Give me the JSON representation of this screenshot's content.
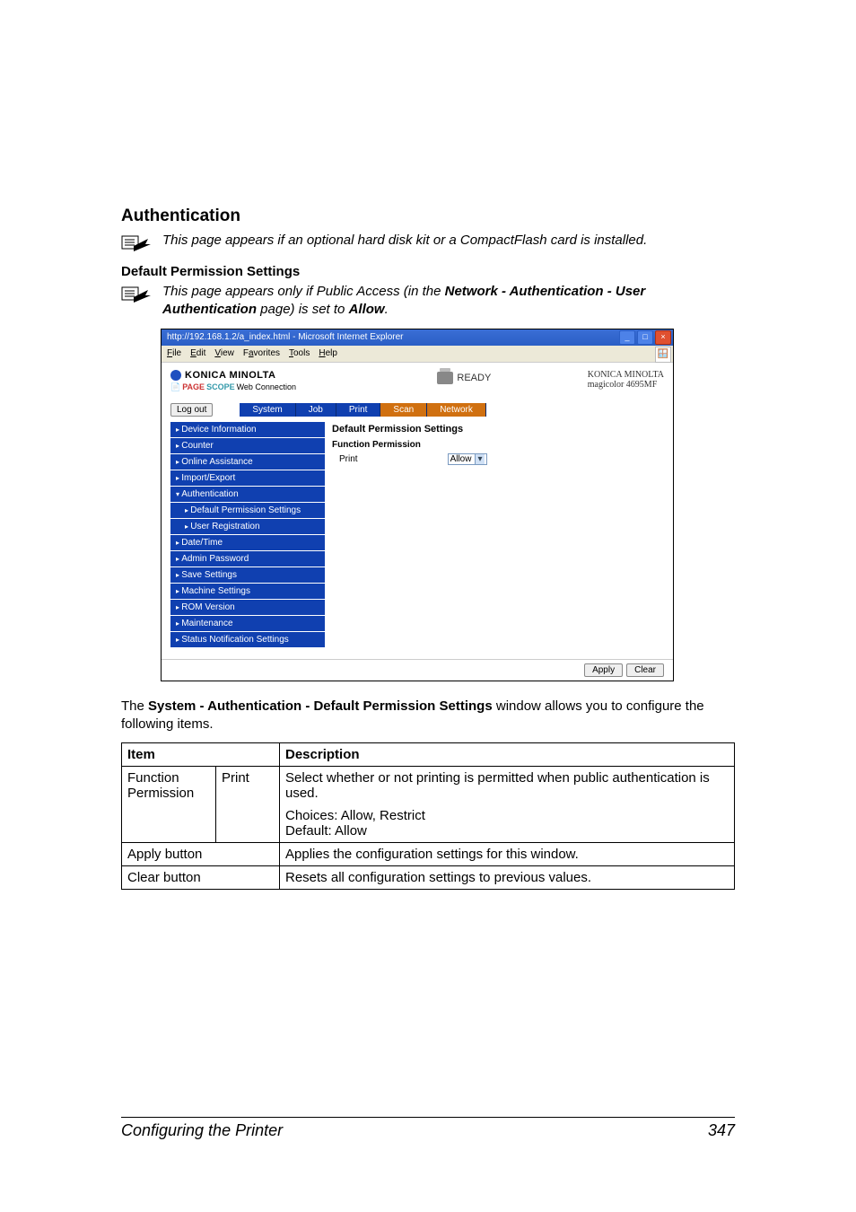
{
  "headings": {
    "authentication": "Authentication",
    "default_permission_settings": "Default Permission Settings"
  },
  "notes": {
    "hard_disk": "This page appears if an optional hard disk kit or a CompactFlash card is installed.",
    "public_access_pre": "This page appears only if Public Access (in the ",
    "public_access_bold": "Network - Authentication - User Authentication",
    "public_access_mid": " page) is set to ",
    "public_access_allow": "Allow",
    "public_access_end": "."
  },
  "screenshot": {
    "titlebar": "http://192.168.1.2/a_index.html - Microsoft Internet Explorer",
    "menus": [
      "File",
      "Edit",
      "View",
      "Favorites",
      "Tools",
      "Help"
    ],
    "brand": {
      "name": "KONICA MINOLTA",
      "pagescope": "Web Connection",
      "ps_prefix1": "PAGE",
      "ps_prefix2": "SCOPE",
      "ready": "READY",
      "right1": "KONICA MINOLTA",
      "right2": "magicolor 4695MF"
    },
    "logout": "Log out",
    "tabs": [
      "System",
      "Job",
      "Print",
      "Scan",
      "Network"
    ],
    "sidenav": [
      {
        "label": "Device Information",
        "type": "item"
      },
      {
        "label": "Counter",
        "type": "item"
      },
      {
        "label": "Online Assistance",
        "type": "item"
      },
      {
        "label": "Import/Export",
        "type": "item"
      },
      {
        "label": "Authentication",
        "type": "open"
      },
      {
        "label": "Default Permission Settings",
        "type": "sub"
      },
      {
        "label": "User Registration",
        "type": "sub"
      },
      {
        "label": "Date/Time",
        "type": "item"
      },
      {
        "label": "Admin Password",
        "type": "item"
      },
      {
        "label": "Save Settings",
        "type": "item"
      },
      {
        "label": "Machine Settings",
        "type": "item"
      },
      {
        "label": "ROM Version",
        "type": "item"
      },
      {
        "label": "Maintenance",
        "type": "item"
      },
      {
        "label": "Status Notification Settings",
        "type": "item"
      }
    ],
    "content": {
      "section_title": "Default Permission Settings",
      "sub_title": "Function Permission",
      "row_label": "Print",
      "row_value": "Allow"
    },
    "footer_buttons": [
      "Apply",
      "Clear"
    ]
  },
  "paragraph": {
    "pre": "The ",
    "bold": "System - Authentication - Default Permission Settings",
    "post": " window allows you to configure the following items."
  },
  "table": {
    "head_item": "Item",
    "head_desc": "Description",
    "rows": [
      {
        "c1": "Function Permission",
        "c2": "Print",
        "desc1": "Select whether or not printing is permitted when public authentication is used.",
        "desc2": "Choices: Allow, Restrict",
        "desc3": "Default:  Allow"
      },
      {
        "c1": "Apply button",
        "desc1": "Applies the configuration settings for this window."
      },
      {
        "c1": "Clear button",
        "desc1": "Resets all configuration settings to previous values."
      }
    ]
  },
  "footer": {
    "left": "Configuring the Printer",
    "right": "347"
  }
}
